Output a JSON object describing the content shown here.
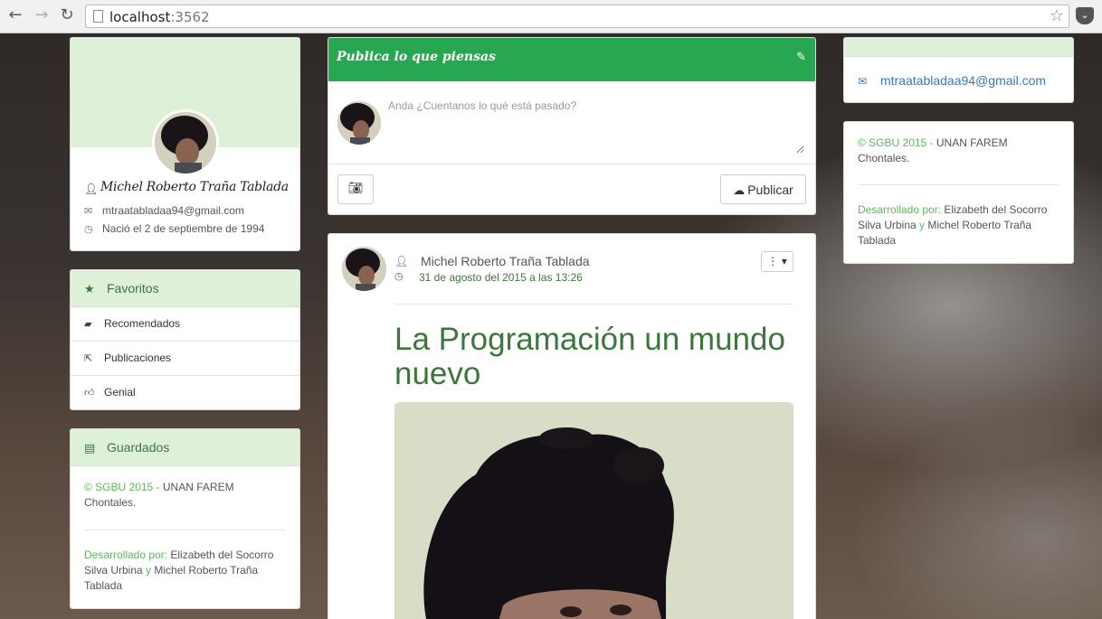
{
  "browser": {
    "back_icon": "back-arrow-icon",
    "url_host": "localhost",
    "url_port": ":3562"
  },
  "profile": {
    "name": "Michel Roberto Traña Tablada",
    "email": "mtraatabladaa94@gmail.com",
    "birth": "Nació el 2 de septiembre de 1994"
  },
  "favorites": {
    "title": "Favoritos",
    "items": [
      {
        "label": "Recomendados",
        "icon": "briefcase-icon"
      },
      {
        "label": "Publicaciones",
        "icon": "share-icon"
      },
      {
        "label": "Genial",
        "icon": "thumbs-up-icon"
      }
    ]
  },
  "saved": {
    "title": "Guardados",
    "copyright_prefix": "© SGBU 2015 - ",
    "copyright_org": "UNAN FAREM Chontales.",
    "dev_label": "Desarrollado por: ",
    "dev_name1": "Elizabeth del Socorro Silva Urbina",
    "dev_sep": " y ",
    "dev_name2": "Michel Roberto Traña Tablada"
  },
  "compose": {
    "title": "Publica lo que piensas",
    "placeholder": "Anda ¿Cuentanos lo qué está pasado?",
    "publish_label": "Publicar"
  },
  "post": {
    "author": "Michel Roberto Traña Tablada",
    "date": "31 de agosto del 2015 a las 13:26",
    "title": "La Programación un mundo nuevo"
  },
  "right": {
    "email": "mtraatabladaa94@gmail.com",
    "copyright_prefix": "© SGBU 2015 - ",
    "copyright_org": "UNAN FAREM Chontales.",
    "dev_label": "Desarrollado por: ",
    "dev_name1": "Elizabeth del Socorro Silva Urbina",
    "dev_sep": " y ",
    "dev_name2": "Michel Roberto Traña Tablada"
  },
  "colors": {
    "accent_green": "#27a850",
    "panel_green": "#dff0d8",
    "text_green": "#3c763d",
    "link_blue": "#337ab7"
  }
}
